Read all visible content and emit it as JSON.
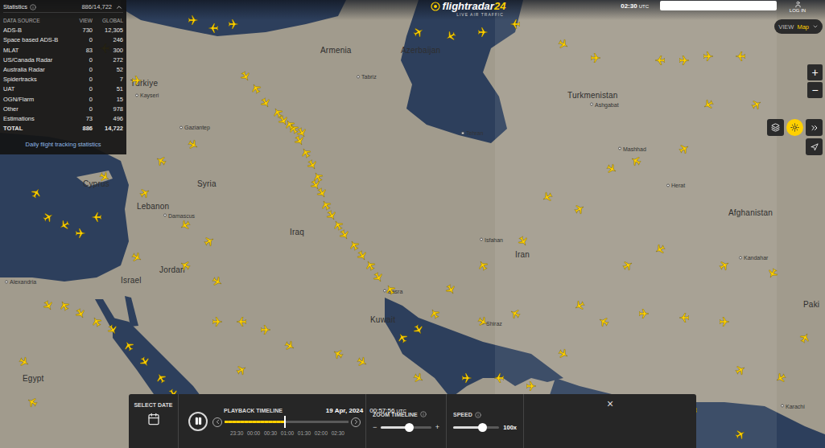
{
  "header": {
    "logo": {
      "name": "flightradar",
      "number": "24"
    },
    "tagline": "LIVE AIR TRAFFIC",
    "time": "02:30",
    "timezone": "UTC",
    "login": "LOG IN"
  },
  "view_control": {
    "label": "VIEW",
    "value": "Map"
  },
  "zoom_buttons": [
    "+",
    "−"
  ],
  "statistics": {
    "title": "Statistics",
    "count": "886/14,722",
    "expanded": true,
    "columns": [
      "DATA SOURCE",
      "VIEW",
      "GLOBAL"
    ],
    "rows": [
      {
        "source": "ADS-B",
        "view": "730",
        "global": "12,305"
      },
      {
        "source": "Space based ADS-B",
        "view": "0",
        "global": "246"
      },
      {
        "source": "MLAT",
        "view": "83",
        "global": "300"
      },
      {
        "source": "US/Canada Radar",
        "view": "0",
        "global": "272"
      },
      {
        "source": "Australia Radar",
        "view": "0",
        "global": "52"
      },
      {
        "source": "Spidertracks",
        "view": "0",
        "global": "7"
      },
      {
        "source": "UAT",
        "view": "0",
        "global": "51"
      },
      {
        "source": "OGN/Flarm",
        "view": "0",
        "global": "15"
      },
      {
        "source": "Other",
        "view": "0",
        "global": "978"
      },
      {
        "source": "Estimations",
        "view": "73",
        "global": "496"
      }
    ],
    "total": {
      "label": "TOTAL",
      "view": "886",
      "global": "14,722"
    },
    "link": "Daily flight tracking statistics"
  },
  "map": {
    "countries": [
      {
        "name": "Türkiye",
        "lon": 35.48,
        "lat": 38.28
      },
      {
        "name": "Armenia",
        "lon": 44.92,
        "lat": 39.56
      },
      {
        "name": "Azerbaijan",
        "lon": 48.92,
        "lat": 39.56
      },
      {
        "name": "Turkmenistan",
        "lon": 57.2,
        "lat": 37.81
      },
      {
        "name": "Cyprus",
        "lon": 33.12,
        "lat": 34.38
      },
      {
        "name": "Syria",
        "lon": 38.8,
        "lat": 34.38
      },
      {
        "name": "Lebanon",
        "lon": 35.8,
        "lat": 33.5
      },
      {
        "name": "Israel",
        "lon": 35.0,
        "lat": 30.63
      },
      {
        "name": "Jordan",
        "lon": 36.92,
        "lat": 31.03
      },
      {
        "name": "Iraq",
        "lon": 43.4,
        "lat": 32.5
      },
      {
        "name": "Iran",
        "lon": 54.6,
        "lat": 31.63
      },
      {
        "name": "Kuwait",
        "lon": 47.4,
        "lat": 29.09
      },
      {
        "name": "Afghanistan",
        "lon": 65.2,
        "lat": 33.25
      },
      {
        "name": "Egypt",
        "lon": 30.12,
        "lat": 26.81
      },
      {
        "name": "Paki",
        "lon": 68.92,
        "lat": 29.69
      }
    ],
    "cities": [
      {
        "name": "Tehran",
        "lon": 52.0,
        "lat": 36.34
      },
      {
        "name": "Tabriz",
        "lon": 46.8,
        "lat": 38.53
      },
      {
        "name": "Mashhad",
        "lon": 59.8,
        "lat": 35.72
      },
      {
        "name": "Ashgabat",
        "lon": 58.4,
        "lat": 37.44
      },
      {
        "name": "Basra",
        "lon": 48.12,
        "lat": 30.19
      },
      {
        "name": "Shiraz",
        "lon": 53.0,
        "lat": 28.94
      },
      {
        "name": "Isfahan",
        "lon": 52.92,
        "lat": 32.19
      },
      {
        "name": "Damascus",
        "lon": 37.2,
        "lat": 33.13
      },
      {
        "name": "Alexandria",
        "lon": 29.32,
        "lat": 30.56
      },
      {
        "name": "Gaziantep",
        "lon": 38.0,
        "lat": 36.56
      },
      {
        "name": "Kayseri",
        "lon": 35.8,
        "lat": 37.81
      },
      {
        "name": "Kandahar",
        "lon": 65.8,
        "lat": 31.5
      },
      {
        "name": "Herat",
        "lon": 62.2,
        "lat": 34.31
      },
      {
        "name": "Karachi",
        "lon": 67.88,
        "lat": 25.72
      }
    ],
    "aircraft": [
      {
        "lon": 41.2,
        "lat": 38.53,
        "hdg": 150
      },
      {
        "lon": 41.72,
        "lat": 38.06,
        "hdg": 330
      },
      {
        "lon": 42.2,
        "lat": 37.5,
        "hdg": 150
      },
      {
        "lon": 42.8,
        "lat": 37.13,
        "hdg": 330
      },
      {
        "lon": 43.08,
        "lat": 36.81,
        "hdg": 150
      },
      {
        "lon": 43.6,
        "lat": 36.5,
        "hdg": 330
      },
      {
        "lon": 43.88,
        "lat": 36.03,
        "hdg": 150
      },
      {
        "lon": 44.2,
        "lat": 35.56,
        "hdg": 330
      },
      {
        "lon": 44.52,
        "lat": 35.09,
        "hdg": 150
      },
      {
        "lon": 44.8,
        "lat": 34.63,
        "hdg": 330
      },
      {
        "lon": 45.0,
        "lat": 34.0,
        "hdg": 150
      },
      {
        "lon": 45.2,
        "lat": 33.53,
        "hdg": 330
      },
      {
        "lon": 45.48,
        "lat": 33.13,
        "hdg": 150
      },
      {
        "lon": 45.8,
        "lat": 32.75,
        "hdg": 330
      },
      {
        "lon": 46.12,
        "lat": 32.38,
        "hdg": 150
      },
      {
        "lon": 46.6,
        "lat": 31.97,
        "hdg": 330
      },
      {
        "lon": 47.0,
        "lat": 31.56,
        "hdg": 150
      },
      {
        "lon": 47.4,
        "lat": 31.19,
        "hdg": 330
      },
      {
        "lon": 47.8,
        "lat": 30.72,
        "hdg": 150
      },
      {
        "lon": 48.4,
        "lat": 30.25,
        "hdg": 330
      },
      {
        "lon": 44.0,
        "lat": 36.34,
        "hdg": 150
      },
      {
        "lon": 43.4,
        "lat": 36.66,
        "hdg": 330
      },
      {
        "lon": 44.68,
        "lat": 34.31,
        "hdg": 150
      },
      {
        "lon": 38.6,
        "lat": 40.72,
        "hdg": 90
      },
      {
        "lon": 39.6,
        "lat": 40.41,
        "hdg": 270
      },
      {
        "lon": 40.6,
        "lat": 40.56,
        "hdg": 90
      },
      {
        "lon": 49.8,
        "lat": 40.25,
        "hdg": 60
      },
      {
        "lon": 51.4,
        "lat": 40.09,
        "hdg": 240
      },
      {
        "lon": 53.0,
        "lat": 40.25,
        "hdg": 90
      },
      {
        "lon": 54.6,
        "lat": 40.56,
        "hdg": 270
      },
      {
        "lon": 57.0,
        "lat": 39.78,
        "hdg": 120
      },
      {
        "lon": 58.6,
        "lat": 39.25,
        "hdg": 90
      },
      {
        "lon": 61.8,
        "lat": 39.16,
        "hdg": 270
      },
      {
        "lon": 63.0,
        "lat": 39.16,
        "hdg": 90
      },
      {
        "lon": 64.2,
        "lat": 39.31,
        "hdg": 90
      },
      {
        "lon": 65.8,
        "lat": 39.31,
        "hdg": 270
      },
      {
        "lon": 66.6,
        "lat": 37.44,
        "hdg": 60
      },
      {
        "lon": 64.2,
        "lat": 37.44,
        "hdg": 240
      },
      {
        "lon": 63.0,
        "lat": 35.72,
        "hdg": 60
      },
      {
        "lon": 60.6,
        "lat": 35.25,
        "hdg": 300
      },
      {
        "lon": 59.4,
        "lat": 34.94,
        "hdg": 120
      },
      {
        "lon": 57.8,
        "lat": 33.38,
        "hdg": 60
      },
      {
        "lon": 56.2,
        "lat": 33.84,
        "hdg": 240
      },
      {
        "lon": 55.0,
        "lat": 32.13,
        "hdg": 150
      },
      {
        "lon": 53.0,
        "lat": 31.19,
        "hdg": 330
      },
      {
        "lon": 51.4,
        "lat": 30.25,
        "hdg": 150
      },
      {
        "lon": 50.6,
        "lat": 29.31,
        "hdg": 330
      },
      {
        "lon": 49.8,
        "lat": 28.69,
        "hdg": 150
      },
      {
        "lon": 49.0,
        "lat": 28.38,
        "hdg": 330
      },
      {
        "lon": 52.2,
        "lat": 26.81,
        "hdg": 90
      },
      {
        "lon": 53.8,
        "lat": 26.81,
        "hdg": 270
      },
      {
        "lon": 55.4,
        "lat": 26.5,
        "hdg": 90
      },
      {
        "lon": 57.0,
        "lat": 27.75,
        "hdg": 120
      },
      {
        "lon": 59.0,
        "lat": 29.0,
        "hdg": 300
      },
      {
        "lon": 61.0,
        "lat": 29.31,
        "hdg": 90
      },
      {
        "lon": 63.0,
        "lat": 29.16,
        "hdg": 270
      },
      {
        "lon": 65.0,
        "lat": 29.0,
        "hdg": 90
      },
      {
        "lon": 65.8,
        "lat": 27.13,
        "hdg": 60
      },
      {
        "lon": 67.8,
        "lat": 26.81,
        "hdg": 240
      },
      {
        "lon": 69.0,
        "lat": 28.38,
        "hdg": 30
      },
      {
        "lon": 67.4,
        "lat": 30.88,
        "hdg": 210
      },
      {
        "lon": 65.0,
        "lat": 31.19,
        "hdg": 60
      },
      {
        "lon": 61.8,
        "lat": 31.81,
        "hdg": 240
      },
      {
        "lon": 60.2,
        "lat": 31.19,
        "hdg": 60
      },
      {
        "lon": 57.8,
        "lat": 29.63,
        "hdg": 240
      },
      {
        "lon": 54.6,
        "lat": 29.31,
        "hdg": 300
      },
      {
        "lon": 53.0,
        "lat": 29.0,
        "hdg": 120
      },
      {
        "lon": 31.4,
        "lat": 33.06,
        "hdg": 60
      },
      {
        "lon": 32.2,
        "lat": 32.75,
        "hdg": 240
      },
      {
        "lon": 33.0,
        "lat": 32.44,
        "hdg": 90
      },
      {
        "lon": 33.8,
        "lat": 33.06,
        "hdg": 270
      },
      {
        "lon": 30.8,
        "lat": 34.0,
        "hdg": 30
      },
      {
        "lon": 34.2,
        "lat": 34.63,
        "hdg": 120
      },
      {
        "lon": 37.0,
        "lat": 35.25,
        "hdg": 300
      },
      {
        "lon": 38.6,
        "lat": 35.88,
        "hdg": 120
      },
      {
        "lon": 36.2,
        "lat": 34.0,
        "hdg": 60
      },
      {
        "lon": 31.4,
        "lat": 29.63,
        "hdg": 150
      },
      {
        "lon": 32.2,
        "lat": 29.63,
        "hdg": 330
      },
      {
        "lon": 33.0,
        "lat": 29.31,
        "hdg": 150
      },
      {
        "lon": 33.8,
        "lat": 29.0,
        "hdg": 330
      },
      {
        "lon": 34.6,
        "lat": 28.69,
        "hdg": 150
      },
      {
        "lon": 35.4,
        "lat": 28.06,
        "hdg": 330
      },
      {
        "lon": 36.2,
        "lat": 27.44,
        "hdg": 150
      },
      {
        "lon": 37.0,
        "lat": 26.81,
        "hdg": 330
      },
      {
        "lon": 37.6,
        "lat": 26.19,
        "hdg": 150
      },
      {
        "lon": 38.2,
        "lat": 25.56,
        "hdg": 330
      },
      {
        "lon": 38.8,
        "lat": 24.94,
        "hdg": 150
      },
      {
        "lon": 39.8,
        "lat": 29.0,
        "hdg": 90
      },
      {
        "lon": 41.0,
        "lat": 29.0,
        "hdg": 270
      },
      {
        "lon": 42.2,
        "lat": 28.69,
        "hdg": 90
      },
      {
        "lon": 43.4,
        "lat": 28.06,
        "hdg": 120
      },
      {
        "lon": 45.8,
        "lat": 27.75,
        "hdg": 300
      },
      {
        "lon": 47.0,
        "lat": 27.44,
        "hdg": 120
      },
      {
        "lon": 41.0,
        "lat": 27.13,
        "hdg": 60
      },
      {
        "lon": 42.6,
        "lat": 25.88,
        "hdg": 240
      },
      {
        "lon": 44.2,
        "lat": 25.25,
        "hdg": 60
      },
      {
        "lon": 46.2,
        "lat": 25.56,
        "hdg": 90
      },
      {
        "lon": 48.2,
        "lat": 25.88,
        "hdg": 270
      },
      {
        "lon": 49.8,
        "lat": 26.81,
        "hdg": 120
      },
      {
        "lon": 51.4,
        "lat": 25.25,
        "hdg": 90
      },
      {
        "lon": 53.0,
        "lat": 24.94,
        "hdg": 270
      },
      {
        "lon": 55.0,
        "lat": 24.63,
        "hdg": 90
      },
      {
        "lon": 57.0,
        "lat": 24.63,
        "hdg": 120
      },
      {
        "lon": 59.0,
        "lat": 24.94,
        "hdg": 300
      },
      {
        "lon": 61.0,
        "lat": 25.25,
        "hdg": 90
      },
      {
        "lon": 63.4,
        "lat": 25.56,
        "hdg": 270
      },
      {
        "lon": 65.8,
        "lat": 24.63,
        "hdg": 60
      },
      {
        "lon": 35.8,
        "lat": 31.5,
        "hdg": 120
      },
      {
        "lon": 38.2,
        "lat": 31.19,
        "hdg": 300
      },
      {
        "lon": 39.8,
        "lat": 30.56,
        "hdg": 120
      },
      {
        "lon": 39.4,
        "lat": 32.13,
        "hdg": 60
      },
      {
        "lon": 38.2,
        "lat": 32.75,
        "hdg": 240
      },
      {
        "lon": 35.8,
        "lat": 38.38,
        "hdg": 90
      },
      {
        "lon": 34.2,
        "lat": 39.63,
        "hdg": 270
      },
      {
        "lon": 33.0,
        "lat": 35.88,
        "hdg": 90
      },
      {
        "lon": 30.2,
        "lat": 27.44,
        "hdg": 120
      },
      {
        "lon": 30.6,
        "lat": 25.88,
        "hdg": 300
      }
    ]
  },
  "playback": {
    "select_date": "SELECT DATE",
    "title": "PLAYBACK TIMELINE",
    "date": "19 Apr, 2024",
    "time": "00:57:56",
    "timezone": "UTC",
    "playing": true,
    "level": 0.49,
    "ticks": [
      "23:30",
      "00:00",
      "00:30",
      "01:00",
      "01:30",
      "02:00",
      "02:30"
    ],
    "zoom": {
      "label": "ZOOM TIMELINE",
      "minus": "−",
      "plus": "+",
      "level": 0.55
    },
    "speed": {
      "label": "SPEED",
      "value": "100x",
      "level": 0.62
    },
    "close": "×"
  }
}
